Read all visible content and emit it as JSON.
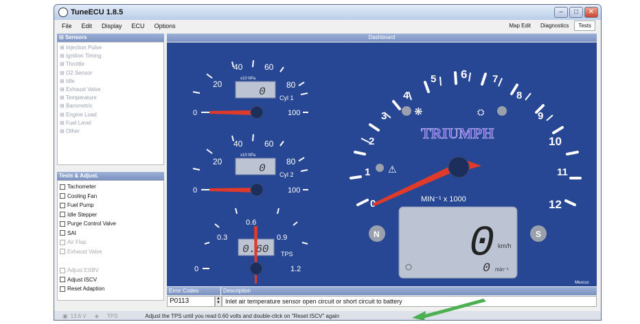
{
  "window": {
    "title": "TuneECU 1.8.5"
  },
  "menu": [
    "File",
    "Edit",
    "Display",
    "ECU",
    "Options"
  ],
  "right_tabs": [
    "Map Edit",
    "Diagnostics",
    "Tests"
  ],
  "sensors": {
    "header": "Sensors",
    "items": [
      "Injection Pulse",
      "Ignition Timing",
      "Throttle",
      "O2 Sensor",
      "Idle",
      "Exhaust Valve",
      "Temperature",
      "Barometric",
      "Engine Load",
      "Fuel Level",
      "Other"
    ]
  },
  "tests": {
    "header": "Tests & Adjust.",
    "items": [
      {
        "label": "Tachometer",
        "enabled": true
      },
      {
        "label": "Cooling Fan",
        "enabled": true
      },
      {
        "label": "Fuel Pump",
        "enabled": true
      },
      {
        "label": "Idle Stepper",
        "enabled": true
      },
      {
        "label": "Purge Control Valve",
        "enabled": true
      },
      {
        "label": "SAI",
        "enabled": true
      },
      {
        "label": "Air Flap",
        "enabled": false
      },
      {
        "label": "Exhaust Valve",
        "enabled": false
      },
      {
        "label": "Adjust EXBV",
        "enabled": false
      },
      {
        "label": "Adjust ISCV",
        "enabled": true
      },
      {
        "label": "Reset Adaption",
        "enabled": true
      }
    ]
  },
  "dashboard": {
    "header": "Dashboard",
    "cyl1": {
      "labels": [
        "20",
        "40",
        "60",
        "80"
      ],
      "unit": "x10 hPa",
      "readout": "0",
      "name": "Cyl 1",
      "min": "0",
      "max": "100"
    },
    "cyl2": {
      "labels": [
        "20",
        "40",
        "60",
        "80"
      ],
      "unit": "x10 hPa",
      "readout": "0",
      "name": "Cyl 2",
      "min": "0",
      "max": "100"
    },
    "tps": {
      "labels": [
        "0.3",
        "0.6",
        "0.9"
      ],
      "readout": "0.60",
      "name": "TPS",
      "min": "0",
      "max": "1.2"
    },
    "tacho": {
      "labels": [
        "0",
        "1",
        "2",
        "3",
        "4",
        "5",
        "6",
        "7",
        "8",
        "9",
        "10",
        "11",
        "12"
      ],
      "unit": "MIN⁻¹ x 1000",
      "brand": "TRIUMPH",
      "speed": "0",
      "speed_unit": "km/h",
      "rpm": "0",
      "rpm_unit": "min⁻¹",
      "neutral": "N",
      "side_stand": "S",
      "maker": "Mexcus"
    }
  },
  "errors": {
    "code_header": "Error Codes",
    "desc_header": "Description",
    "code": "P0113",
    "description": "Inlet air temperature sensor open circuit or short circuit to battery"
  },
  "status": {
    "voltage": "13.6 V",
    "tps": "TPS",
    "message": "Adjust the TPS until you read 0.60 volts and double-click on \"Reset ISCV\" again"
  },
  "colors": {
    "dial_bg": "#274693",
    "needle": "#e03a2a",
    "lcd": "#bcc4d4",
    "header": "#8aa0cc"
  }
}
